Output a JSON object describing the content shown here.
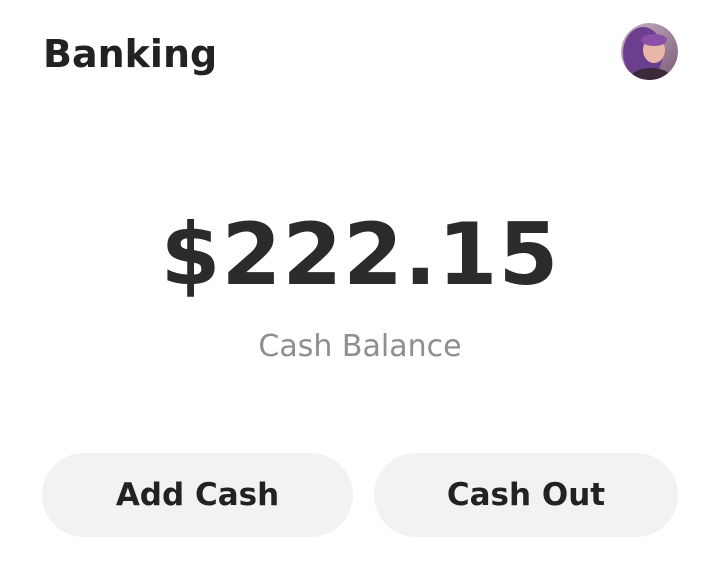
{
  "header": {
    "title": "Banking",
    "avatar_icon": "user-avatar-photo"
  },
  "balance": {
    "amount": "$222.15",
    "label": "Cash Balance"
  },
  "actions": {
    "add_cash_label": "Add Cash",
    "cash_out_label": "Cash Out"
  },
  "colors": {
    "background": "#ffffff",
    "button_background": "#f2f2f2",
    "primary_text": "#222222",
    "secondary_text": "#8e8e8e"
  }
}
